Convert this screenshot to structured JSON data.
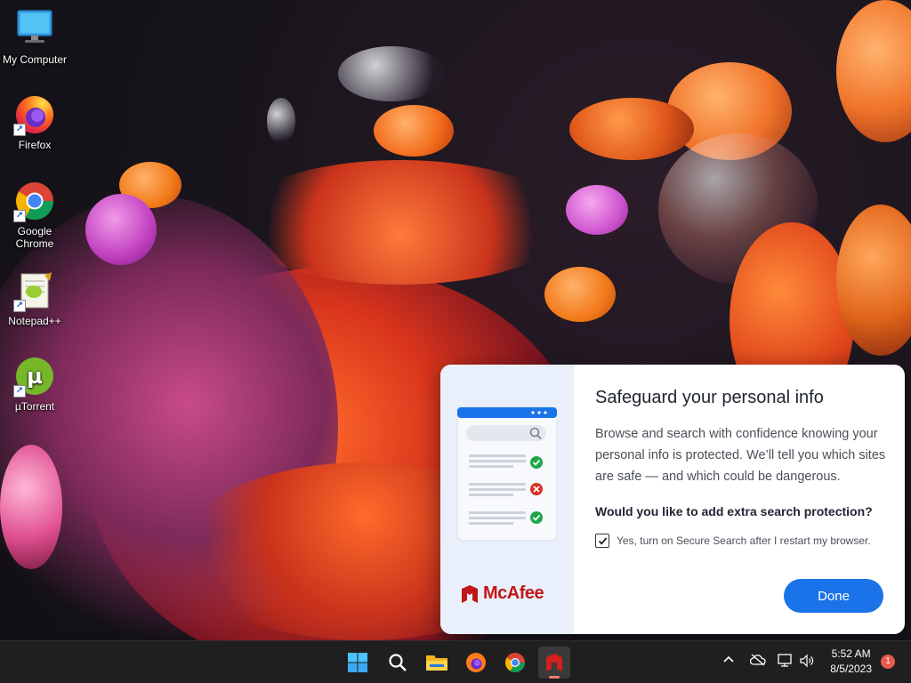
{
  "desktop": {
    "icons": [
      {
        "label": "My Computer"
      },
      {
        "label": "Firefox"
      },
      {
        "label": "Google Chrome"
      },
      {
        "label": "Notepad++"
      },
      {
        "label": "µTorrent"
      }
    ]
  },
  "popup": {
    "title": "Safeguard your personal info",
    "body": "Browse and search with confidence knowing your personal info is protected. We’ll tell you which sites are safe — and which could be dangerous.",
    "question": "Would you like to add extra search protection?",
    "checkbox_label": "Yes, turn on Secure Search after I restart my browser.",
    "checkbox_checked": true,
    "done_label": "Done",
    "brand": "McAfee"
  },
  "taskbar": {
    "apps": [
      "start-icon",
      "search-icon",
      "file-explorer-icon",
      "firefox-icon",
      "chrome-icon",
      "mcafee-icon"
    ],
    "time": "5:52 AM",
    "date": "8/5/2023",
    "notification_count": "1"
  },
  "colors": {
    "accent": "#1a73e8",
    "brand": "#c01818"
  }
}
